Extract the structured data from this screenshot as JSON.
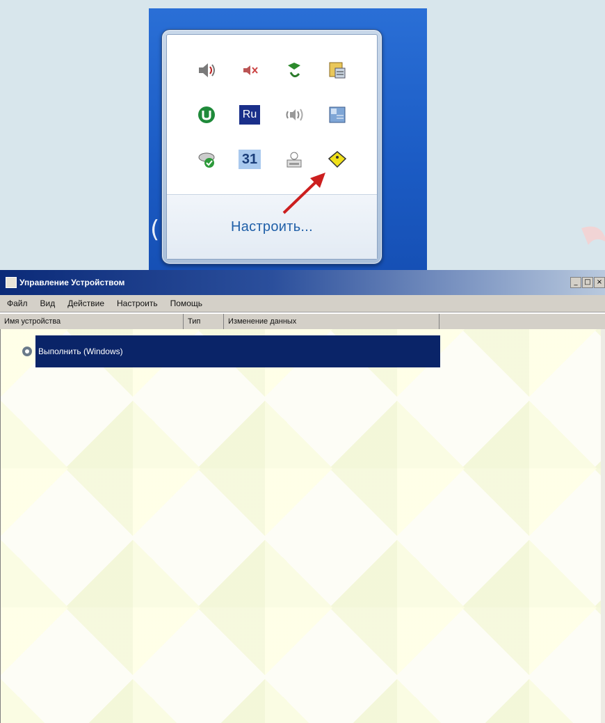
{
  "tray": {
    "icons": [
      {
        "name": "volume-icon",
        "row": 0,
        "col": 0
      },
      {
        "name": "muted-speaker-icon",
        "row": 0,
        "col": 1
      },
      {
        "name": "network-plug-icon",
        "row": 0,
        "col": 2
      },
      {
        "name": "document-manager-icon",
        "row": 0,
        "col": 3
      },
      {
        "name": "utorrent-icon",
        "row": 1,
        "col": 0
      },
      {
        "name": "ru-language-icon",
        "row": 1,
        "col": 1,
        "text": "Ru"
      },
      {
        "name": "sound-waves-icon",
        "row": 1,
        "col": 2
      },
      {
        "name": "app-window-icon",
        "row": 1,
        "col": 3
      },
      {
        "name": "cloud-check-icon",
        "row": 2,
        "col": 0
      },
      {
        "name": "calendar-icon",
        "row": 2,
        "col": 1,
        "text": "31"
      },
      {
        "name": "printer-user-icon",
        "row": 2,
        "col": 2
      },
      {
        "name": "safely-remove-hardware-icon",
        "row": 2,
        "col": 3
      }
    ],
    "customize_label": "Настроить..."
  },
  "window": {
    "title": "Управление Устройством",
    "menu": [
      "Файл",
      "Вид",
      "Действие",
      "Настроить",
      "Помощь"
    ],
    "columns": [
      "Имя устройства",
      "Тип",
      "Изменение данных"
    ],
    "selected_row_label": "Выполнить (Windows)"
  },
  "colors": {
    "selection": "#0a2468",
    "title_start": "#0b2a78",
    "tray_background": "#1b5bc4",
    "arrow": "#cc1f1f"
  }
}
